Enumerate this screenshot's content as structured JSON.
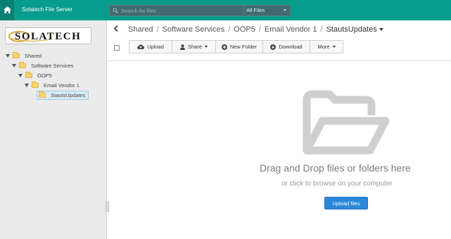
{
  "topbar": {
    "app_title": "Solatech File Server",
    "search_placeholder": "Search for files",
    "filter_value": "All Files",
    "colors": {
      "bar": "#079c8c",
      "home": "#0a8073"
    }
  },
  "sidebar": {
    "logo_text": "SOLATECH",
    "tree": [
      {
        "label": "Shared",
        "icon": "folder-icon"
      },
      {
        "label": "Software Services",
        "icon": "folder-icon"
      },
      {
        "label": "OOP5",
        "icon": "folder-icon"
      },
      {
        "label": "Email Vendor 1",
        "icon": "folder-icon"
      },
      {
        "label": "StautsUpdates",
        "icon": "folder-icon",
        "selected": true
      }
    ]
  },
  "breadcrumb": {
    "items": [
      "Shared",
      "Software Services",
      "OOP5",
      "Email Vendor 1"
    ],
    "current": "StautsUpdates",
    "separator": "/"
  },
  "toolbar": {
    "upload": "Upload",
    "share": "Share",
    "new_folder": "New Folder",
    "download": "Download",
    "more": "More"
  },
  "dropzone": {
    "title": "Drag and Drop files or folders here",
    "subtitle": "or click to browse on your computer",
    "button": "Upload files",
    "button_color": "#2b88d8"
  }
}
